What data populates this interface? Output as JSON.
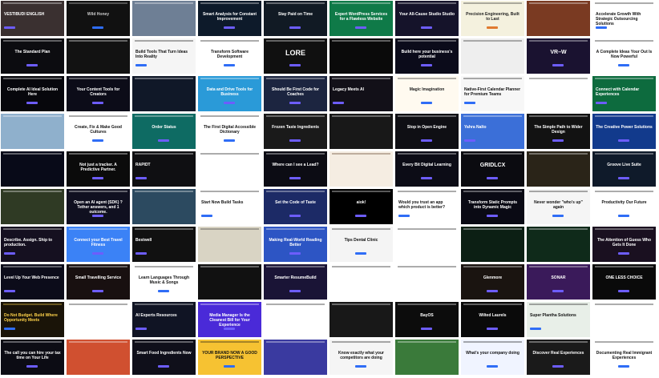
{
  "tiles": [
    {
      "bg": "#3a3030",
      "fg": "#ffffff",
      "title": "VESTIBUDI ENGLISH",
      "align": "left"
    },
    {
      "bg": "#111111",
      "fg": "#cccccc",
      "title": "Wild Honey"
    },
    {
      "bg": "#6e7f95",
      "fg": "#ffffff",
      "title": ""
    },
    {
      "bg": "#0d1a2a",
      "fg": "#ffffff",
      "title": "Smart Analysis for Constant Improvement"
    },
    {
      "bg": "#111a24",
      "fg": "#ffffff",
      "title": "Stay Paid on Time"
    },
    {
      "bg": "#0f7a48",
      "fg": "#ffffff",
      "title": "Expert WordPress Services for a Flawless Website"
    },
    {
      "bg": "#15132a",
      "fg": "#ffffff",
      "title": "Your All-Cause Studio Studio"
    },
    {
      "bg": "#f4f1de",
      "fg": "#222222",
      "title": "Precision Engineering, Built to Last",
      "accent": "#e07a2f"
    },
    {
      "bg": "#7a3a22",
      "fg": "#ffffff",
      "title": ""
    },
    {
      "bg": "#ffffff",
      "fg": "#111111",
      "title": "Accelerate Growth With Strategic Outsourcing Solutions",
      "align": "left"
    },
    {
      "bg": "#0c0c10",
      "fg": "#ffffff",
      "title": "The Standard Plan"
    },
    {
      "bg": "#121212",
      "fg": "#ffffff",
      "title": ""
    },
    {
      "bg": "#f5f5f5",
      "fg": "#111111",
      "title": "Build Tools That Turn Ideas Into Reality",
      "align": "left"
    },
    {
      "bg": "#ffffff",
      "fg": "#111111",
      "title": "Transform Software Development"
    },
    {
      "bg": "#101010",
      "fg": "#ffffff",
      "title": "LORE",
      "size": "9px"
    },
    {
      "bg": "#0a0a0a",
      "fg": "#ffffff",
      "title": ""
    },
    {
      "bg": "#0b0b1a",
      "fg": "#ffffff",
      "title": "Build here your business's potential"
    },
    {
      "bg": "#eeeeee",
      "fg": "#222222",
      "title": ""
    },
    {
      "bg": "#1a1230",
      "fg": "#ffffff",
      "title": "VR–W",
      "size": "7px"
    },
    {
      "bg": "#ffffff",
      "fg": "#111111",
      "title": "A Complete Ideas Your Out Is Now Powerful"
    },
    {
      "bg": "#07070c",
      "fg": "#ffffff",
      "title": "Complete AI Ideal Solution Here"
    },
    {
      "bg": "#0c0c18",
      "fg": "#ffffff",
      "title": "Your Content Tools for Creators"
    },
    {
      "bg": "#101828",
      "fg": "#ffffff",
      "title": ""
    },
    {
      "bg": "#2a9ad8",
      "fg": "#ffffff",
      "title": "Data and Drive Tools for Business"
    },
    {
      "bg": "#1c2540",
      "fg": "#ffffff",
      "title": "Should Be First Code for Coaches"
    },
    {
      "bg": "#121018",
      "fg": "#ffffff",
      "title": "Legacy Meets AI",
      "align": "left"
    },
    {
      "bg": "#fffaf0",
      "fg": "#222222",
      "title": "Magic Imagination"
    },
    {
      "bg": "#f7f7f7",
      "fg": "#111111",
      "title": "Native-First Calendar Planner for Premium Teams",
      "align": "left"
    },
    {
      "bg": "#ffffff",
      "fg": "#222222",
      "title": ""
    },
    {
      "bg": "#0d6b3e",
      "fg": "#ffffff",
      "title": "Connect with Calendar Experiences",
      "align": "left"
    },
    {
      "bg": "#8fb0cc",
      "fg": "#ffffff",
      "title": ""
    },
    {
      "bg": "#ffffff",
      "fg": "#111111",
      "title": "Create, Fix & Make Good Cultures"
    },
    {
      "bg": "#0e6b63",
      "fg": "#ffffff",
      "title": "Order Status"
    },
    {
      "bg": "#ffffff",
      "fg": "#111111",
      "title": "The First Digital Accessible Dictionary"
    },
    {
      "bg": "#1a1a1a",
      "fg": "#ffffff",
      "title": "Frozen Taste Ingredients"
    },
    {
      "bg": "#181818",
      "fg": "#ffffff",
      "title": ""
    },
    {
      "bg": "#0f0f14",
      "fg": "#ffffff",
      "title": "Stop in Open Engine"
    },
    {
      "bg": "#3b6fd8",
      "fg": "#ffffff",
      "title": "Yahra Nalto",
      "align": "left"
    },
    {
      "bg": "#121212",
      "fg": "#ffffff",
      "title": "The Simple Path to Wider Design"
    },
    {
      "bg": "#123a8c",
      "fg": "#ffffff",
      "title": "The Creative Power Solutions"
    },
    {
      "bg": "#080a18",
      "fg": "#ffffff",
      "title": ""
    },
    {
      "bg": "#0b0b0b",
      "fg": "#ffffff",
      "title": "Not just a tracker. A Predictive Partner."
    },
    {
      "bg": "#0f0f12",
      "fg": "#ffffff",
      "title": "RAPIDT",
      "align": "left"
    },
    {
      "bg": "#ffffff",
      "fg": "#111111",
      "title": ""
    },
    {
      "bg": "#0c0c14",
      "fg": "#ffffff",
      "title": "Where can I see a Lead?"
    },
    {
      "bg": "#f5ede2",
      "fg": "#5a3a20",
      "title": ""
    },
    {
      "bg": "#0c0c16",
      "fg": "#ffffff",
      "title": "Every Bit Digital Learning"
    },
    {
      "bg": "#0b0b10",
      "fg": "#ffffff",
      "title": "GRIDLCX",
      "size": "7px"
    },
    {
      "bg": "#2a2418",
      "fg": "#ffffff",
      "title": ""
    },
    {
      "bg": "#0f1a2a",
      "fg": "#ffffff",
      "title": "Groove Live Suite"
    },
    {
      "bg": "#2f3a24",
      "fg": "#ffffff",
      "title": ""
    },
    {
      "bg": "#101020",
      "fg": "#ffffff",
      "title": "Open an AI agent (SDK) ? Tether answers, and 1 outcome."
    },
    {
      "bg": "#2c4a60",
      "fg": "#ffffff",
      "title": ""
    },
    {
      "bg": "#ffffff",
      "fg": "#111111",
      "title": "Start Now Build Tasks",
      "align": "left"
    },
    {
      "bg": "#1c2a66",
      "fg": "#ffffff",
      "title": "Set the Code of Taste"
    },
    {
      "bg": "#000000",
      "fg": "#ffffff",
      "title": "aiok!"
    },
    {
      "bg": "#ffffff",
      "fg": "#111111",
      "title": "Would you trust an app which product is better?",
      "align": "left"
    },
    {
      "bg": "#0a0a14",
      "fg": "#ffffff",
      "title": "Transform Static Prompts into Dynamic Magic"
    },
    {
      "bg": "#f5f5f5",
      "fg": "#111111",
      "title": "Never wonder \"who's up\" again"
    },
    {
      "bg": "#ffffff",
      "fg": "#111111",
      "title": "Productivity Our Future"
    },
    {
      "bg": "#151020",
      "fg": "#ffffff",
      "title": "Describe. Assign. Ship to production.",
      "align": "left"
    },
    {
      "bg": "#3b82f6",
      "fg": "#ffffff",
      "title": "Connect your Best Travel Fitness"
    },
    {
      "bg": "#111111",
      "fg": "#ffffff",
      "title": "Bestwell",
      "align": "left"
    },
    {
      "bg": "#d9d4c4",
      "fg": "#333333",
      "title": ""
    },
    {
      "bg": "#2d55c4",
      "fg": "#ffffff",
      "title": "Making Real-World Reading Better"
    },
    {
      "bg": "#f4f4f4",
      "fg": "#111111",
      "title": "Tips Dental Clinic"
    },
    {
      "bg": "#ffffff",
      "fg": "#111111",
      "title": ""
    },
    {
      "bg": "#0c1f14",
      "fg": "#ffffff",
      "title": ""
    },
    {
      "bg": "#0f2a1a",
      "fg": "#ffffff",
      "title": ""
    },
    {
      "bg": "#1a1020",
      "fg": "#ffffff",
      "title": "The Attention of Guess Who Gets It Done"
    },
    {
      "bg": "#0c0c1a",
      "fg": "#ffffff",
      "title": "Level Up Your Web Presence",
      "align": "left"
    },
    {
      "bg": "#181010",
      "fg": "#ffffff",
      "title": "Small Travelling Service"
    },
    {
      "bg": "#ffffff",
      "fg": "#111111",
      "title": "Learn Languages Through Music & Songs"
    },
    {
      "bg": "#111111",
      "fg": "#ffffff",
      "title": ""
    },
    {
      "bg": "#1a1436",
      "fg": "#ffffff",
      "title": "Smarter ResumeBuild"
    },
    {
      "bg": "#ffffff",
      "fg": "#111111",
      "title": ""
    },
    {
      "bg": "#ffffff",
      "fg": "#111111",
      "title": ""
    },
    {
      "bg": "#1a1410",
      "fg": "#ffffff",
      "title": "Glenmore"
    },
    {
      "bg": "#3a1a5a",
      "fg": "#ffffff",
      "title": "SONAR"
    },
    {
      "bg": "#0a0a0a",
      "fg": "#ffffff",
      "title": "ONE LESS CHOICE"
    },
    {
      "bg": "#1a1408",
      "fg": "#ffd34a",
      "title": "Do Not Budget. Build Where Opportunity Meets",
      "align": "left"
    },
    {
      "bg": "#ffffff",
      "fg": "#111111",
      "title": ""
    },
    {
      "bg": "#101424",
      "fg": "#ffffff",
      "title": "AI Experts Resources",
      "align": "left"
    },
    {
      "bg": "#4a2ad8",
      "fg": "#ffffff",
      "title": "Media Manager Is the Cleanest Bill for Your Experience"
    },
    {
      "bg": "#ffffff",
      "fg": "#111111",
      "title": ""
    },
    {
      "bg": "#181818",
      "fg": "#ffffff",
      "title": ""
    },
    {
      "bg": "#0c0c0c",
      "fg": "#ffffff",
      "title": "BayOS"
    },
    {
      "bg": "#0a0a0a",
      "fg": "#ffffff",
      "title": "Wilted Laurels"
    },
    {
      "bg": "#e8efe8",
      "fg": "#111111",
      "title": "Super Plantha Solutions",
      "align": "left"
    },
    {
      "bg": "#ffffff",
      "fg": "#111111",
      "title": ""
    },
    {
      "bg": "#0c0c14",
      "fg": "#ffffff",
      "title": "The call you can hire your tax time on Your Life"
    },
    {
      "bg": "#d05030",
      "fg": "#ffffff",
      "title": ""
    },
    {
      "bg": "#0f0f1a",
      "fg": "#ffffff",
      "title": "Smart Food Ingredients Now"
    },
    {
      "bg": "#f6c232",
      "fg": "#111111",
      "title": "YOUR BRAND NOW A GOOD PERSPECTIVE"
    },
    {
      "bg": "#3a3aa0",
      "fg": "#ffffff",
      "title": ""
    },
    {
      "bg": "#f5f5f5",
      "fg": "#111111",
      "title": "Know exactly what your competitors are doing"
    },
    {
      "bg": "#3a7a3a",
      "fg": "#ffffff",
      "title": ""
    },
    {
      "bg": "#f0f4ff",
      "fg": "#111111",
      "title": "What's your company doing"
    },
    {
      "bg": "#1a1a1a",
      "fg": "#ffffff",
      "title": "Discover Real Experiences"
    },
    {
      "bg": "#ffffff",
      "fg": "#111111",
      "title": "Documenting Real Immigrant Experiences"
    }
  ]
}
